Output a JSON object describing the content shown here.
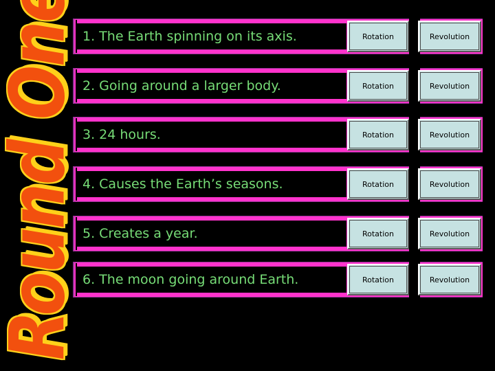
{
  "slide": {
    "title": "Round One",
    "background_color": "#000000",
    "title_fill_color": "#F2500E",
    "title_outline_color": "#FFD11A",
    "question_text_color": "#77DD77",
    "frame_color": "#FF33CC",
    "button_face_color": "#C6E2E2"
  },
  "questions": [
    {
      "number": "1",
      "text": "1. The Earth spinning on its axis.",
      "rotation_label": "Rotation",
      "revolution_label": "Revolution"
    },
    {
      "number": "2",
      "text": "2. Going around a larger body.",
      "rotation_label": "Rotation",
      "revolution_label": "Revolution"
    },
    {
      "number": "3",
      "text": "3. 24 hours.",
      "rotation_label": "Rotation",
      "revolution_label": "Revolution"
    },
    {
      "number": "4",
      "text": "4. Causes the Earth’s seasons.",
      "rotation_label": "Rotation",
      "revolution_label": "Revolution"
    },
    {
      "number": "5",
      "text": "5. Creates a year.",
      "rotation_label": "Rotation",
      "revolution_label": "Revolution"
    },
    {
      "number": "6",
      "text": "6. The moon going around Earth.",
      "rotation_label": "Rotation",
      "revolution_label": "Revolution"
    }
  ]
}
